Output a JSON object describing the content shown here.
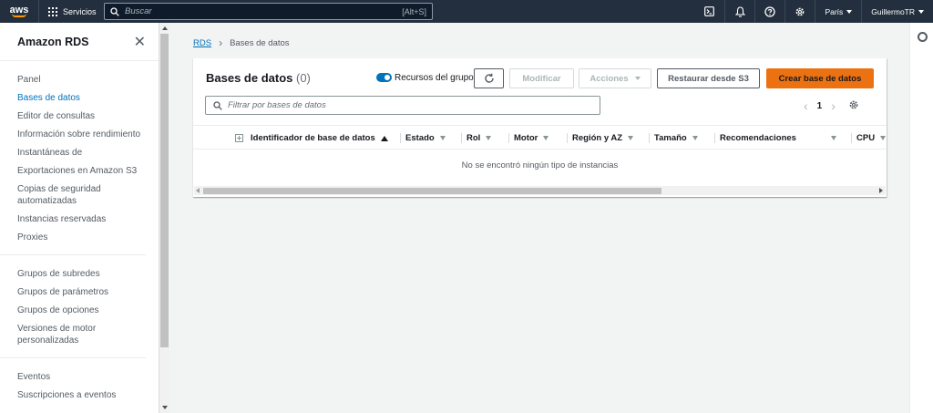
{
  "topnav": {
    "logo_text": "aws",
    "services_label": "Servicios",
    "search_placeholder": "Buscar",
    "search_shortcut": "[Alt+S]",
    "region_label": "París",
    "user_label": "GuillermoTR"
  },
  "sidebar": {
    "title": "Amazon RDS",
    "group1": [
      {
        "label": "Panel",
        "active": false
      },
      {
        "label": "Bases de datos",
        "active": true
      },
      {
        "label": "Editor de consultas",
        "active": false
      },
      {
        "label": "Información sobre rendimiento",
        "active": false
      },
      {
        "label": "Instantáneas de",
        "active": false
      },
      {
        "label": "Exportaciones en Amazon S3",
        "active": false
      },
      {
        "label": "Copias de seguridad automatizadas",
        "active": false
      },
      {
        "label": "Instancias reservadas",
        "active": false
      },
      {
        "label": "Proxies",
        "active": false
      }
    ],
    "group2": [
      {
        "label": "Grupos de subredes"
      },
      {
        "label": "Grupos de parámetros"
      },
      {
        "label": "Grupos de opciones"
      },
      {
        "label": "Versiones de motor personalizadas"
      }
    ],
    "group3": [
      {
        "label": "Eventos"
      },
      {
        "label": "Suscripciones a eventos"
      }
    ]
  },
  "breadcrumb": {
    "root": "RDS",
    "current": "Bases de datos"
  },
  "panel": {
    "title": "Bases de datos",
    "count": "(0)",
    "toggle_label": "Recursos del grupo",
    "modify_label": "Modificar",
    "actions_label": "Acciones",
    "restore_label": "Restaurar desde S3",
    "create_label": "Crear base de datos",
    "filter_placeholder": "Filtrar por bases de datos",
    "page_number": "1",
    "columns": [
      "Identificador de base de datos",
      "Estado",
      "Rol",
      "Motor",
      "Región y AZ",
      "Tamaño",
      "Recomendaciones",
      "CPU"
    ],
    "empty_text": "No se encontró ningún tipo de instancias"
  },
  "colors": {
    "nav_bg": "#232f3e",
    "accent": "#0073bb",
    "primary_button": "#ec7211"
  }
}
